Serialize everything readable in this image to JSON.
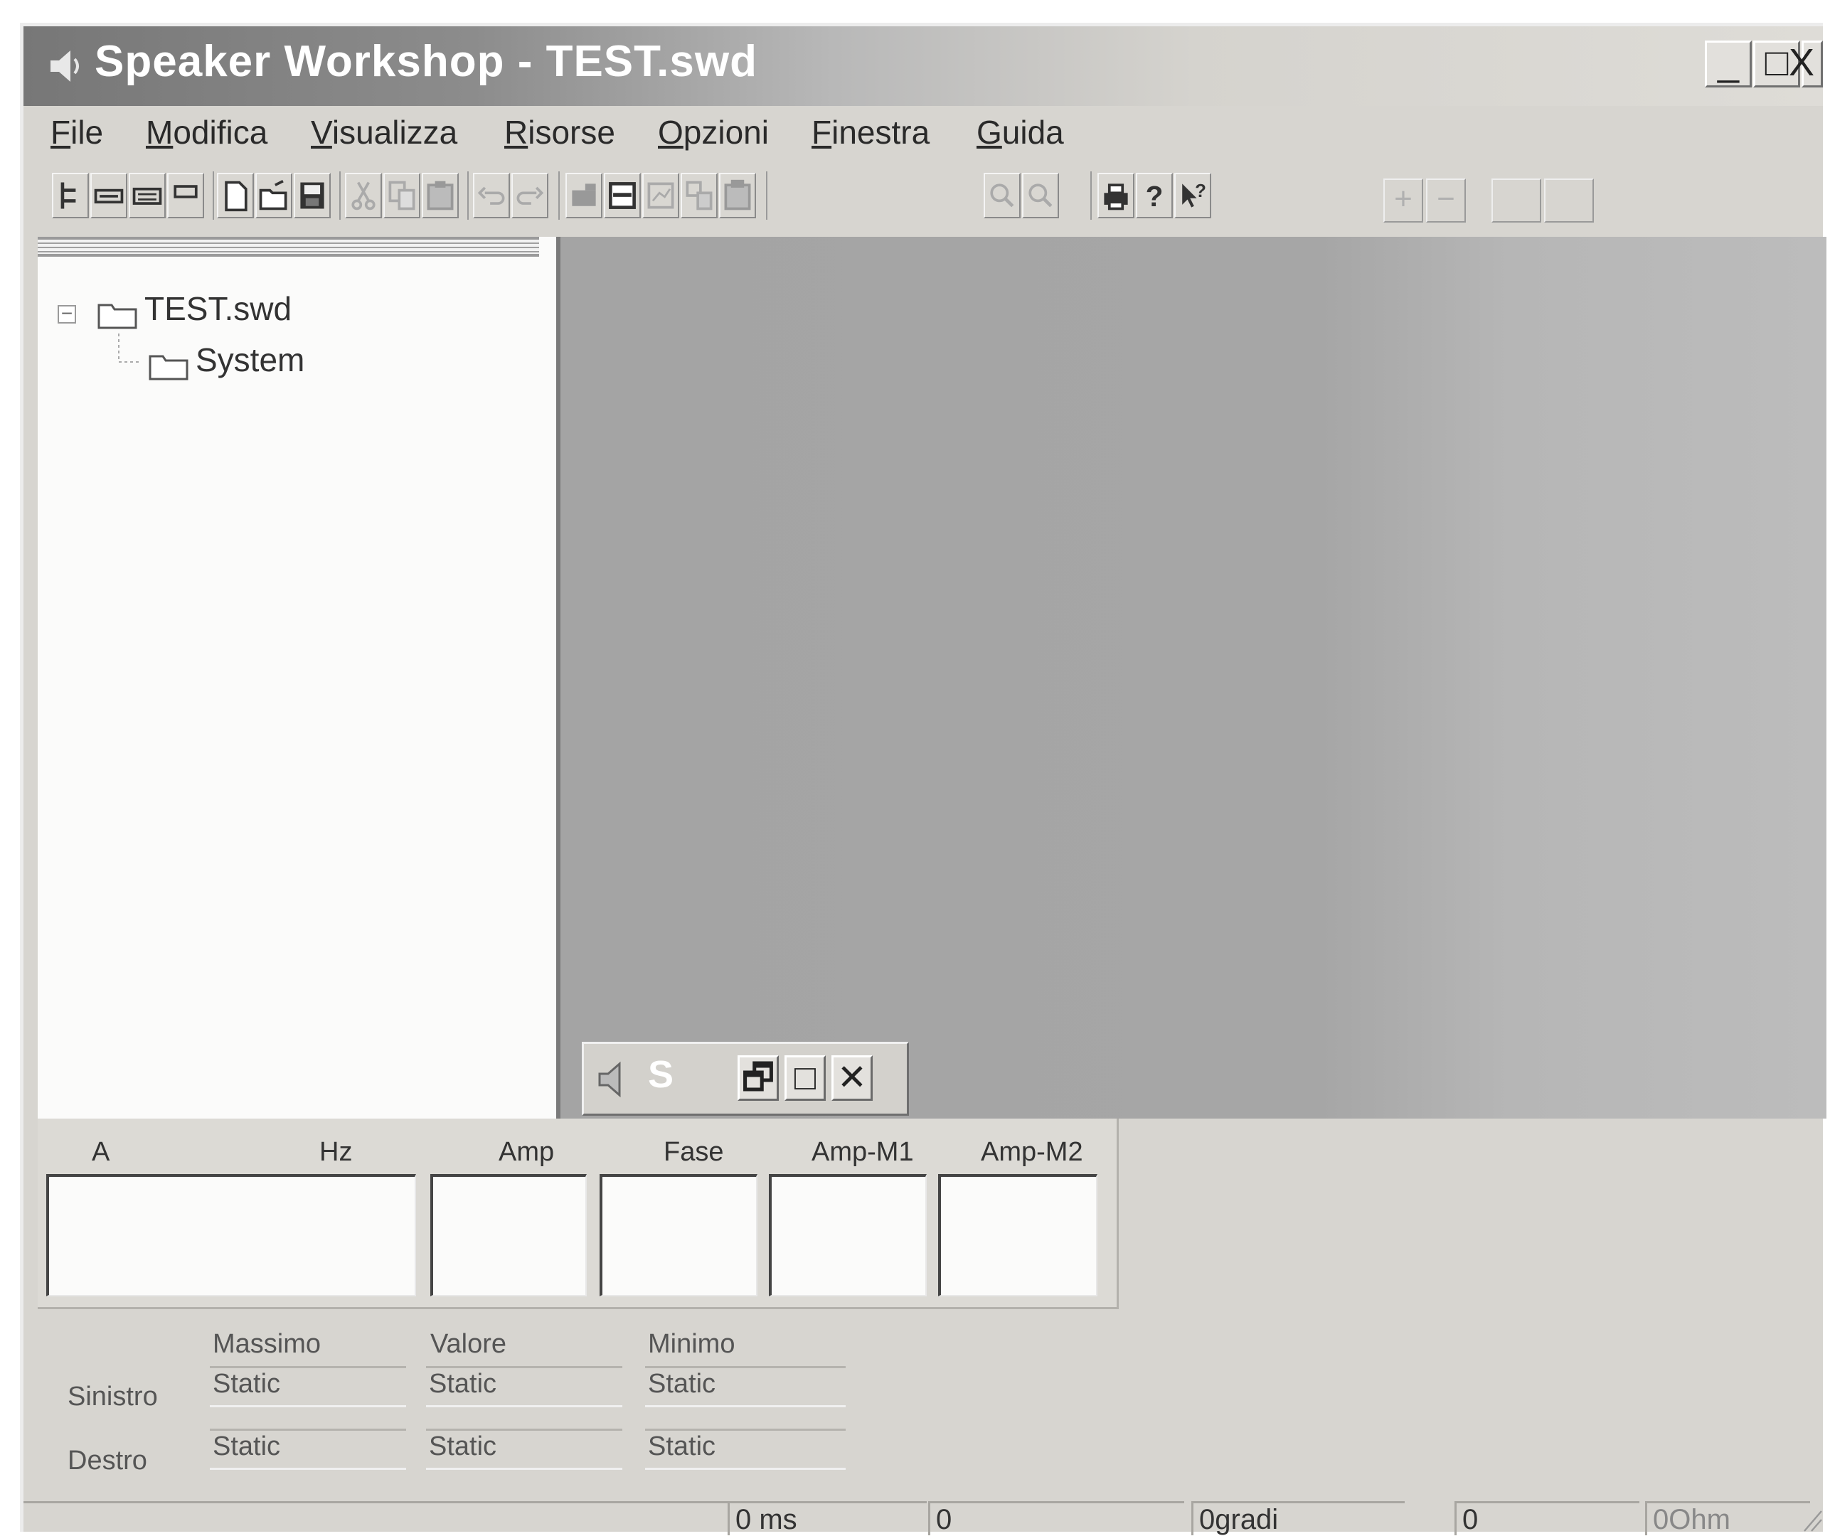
{
  "window": {
    "title": "Speaker Workshop - TEST.swd",
    "controls": {
      "minimize": "_",
      "maximize": "□",
      "close": "X"
    }
  },
  "menubar": {
    "items": [
      {
        "label": "File",
        "accel": "F"
      },
      {
        "label": "Modifica",
        "accel": "M"
      },
      {
        "label": "Visualizza",
        "accel": "V"
      },
      {
        "label": "Risorse",
        "accel": "R"
      },
      {
        "label": "Opzioni",
        "accel": "O"
      },
      {
        "label": "Finestra",
        "accel": "F"
      },
      {
        "label": "Guida",
        "accel": "G"
      }
    ]
  },
  "toolbar": {
    "icons": [
      "tree-view-icon",
      "list-view-icon",
      "grid-view-icon",
      "small-view-icon",
      "new-file-icon",
      "open-folder-icon",
      "save-disk-icon",
      "cut-icon",
      "copy-icon",
      "paste-icon",
      "undo-icon",
      "redo-icon",
      "properties-icon",
      "dataset-icon",
      "chart-icon",
      "network-icon",
      "driver-icon",
      "zoom-in-icon",
      "zoom-out-icon",
      "print-icon",
      "help-icon",
      "context-help-icon"
    ],
    "right": {
      "plus": "+",
      "minus": "−"
    }
  },
  "tree": {
    "root": {
      "label": "TEST.swd",
      "expander": "−"
    },
    "children": [
      {
        "label": "System"
      }
    ]
  },
  "minimized_window": {
    "title": "S",
    "controls": {
      "restore": "🗗",
      "maximize": "□",
      "close": "✕"
    }
  },
  "data_panel": {
    "columns": [
      "A",
      "Hz",
      "Amp",
      "Fase",
      "Amp-M1",
      "Amp-M2"
    ]
  },
  "levels": {
    "headers": [
      "Massimo",
      "Valore",
      "Minimo"
    ],
    "rows": [
      {
        "label": "Sinistro",
        "values": [
          "Static",
          "Static",
          "Static"
        ]
      },
      {
        "label": "Destro",
        "values": [
          "Static",
          "Static",
          "Static"
        ]
      }
    ]
  },
  "statusbar": {
    "fields": [
      "0 ms",
      "0",
      "0gradi",
      "0",
      "0Ohm"
    ]
  },
  "colors": {
    "face": "#d7d5d0",
    "mdi_bg": "#a6a6a6",
    "title_text": "#ffffff"
  }
}
